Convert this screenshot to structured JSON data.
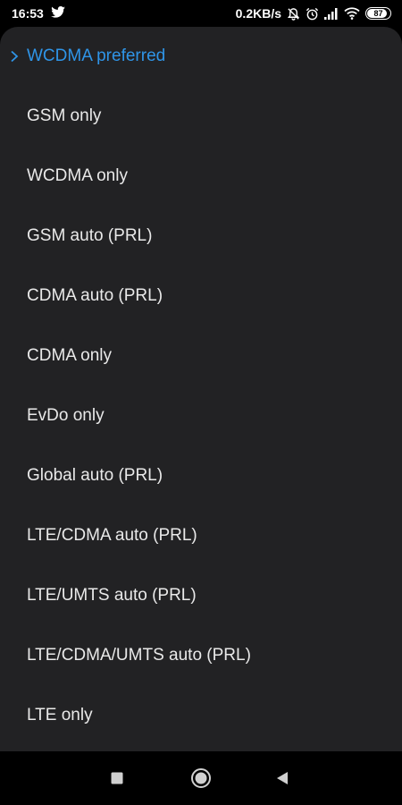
{
  "status_bar": {
    "time": "16:53",
    "net_speed": "0.2KB/s",
    "battery": "87",
    "icons": [
      "twitter-icon",
      "mute-bell-icon",
      "alarm-icon",
      "signal-icon",
      "wifi-icon",
      "battery-icon"
    ]
  },
  "options": [
    {
      "label": "WCDMA preferred",
      "selected": true
    },
    {
      "label": "GSM only",
      "selected": false
    },
    {
      "label": "WCDMA only",
      "selected": false
    },
    {
      "label": "GSM auto (PRL)",
      "selected": false
    },
    {
      "label": "CDMA auto (PRL)",
      "selected": false
    },
    {
      "label": "CDMA only",
      "selected": false
    },
    {
      "label": "EvDo only",
      "selected": false
    },
    {
      "label": "Global auto (PRL)",
      "selected": false
    },
    {
      "label": "LTE/CDMA auto (PRL)",
      "selected": false
    },
    {
      "label": "LTE/UMTS auto (PRL)",
      "selected": false
    },
    {
      "label": "LTE/CDMA/UMTS auto (PRL)",
      "selected": false
    },
    {
      "label": "LTE only",
      "selected": false
    }
  ],
  "colors": {
    "accent": "#2f95e8",
    "sheet_background": "#222224",
    "text": "#e9e9e9"
  },
  "nav_bar": {
    "icons": [
      "recents-square-icon",
      "home-circle-icon",
      "back-triangle-icon"
    ]
  }
}
